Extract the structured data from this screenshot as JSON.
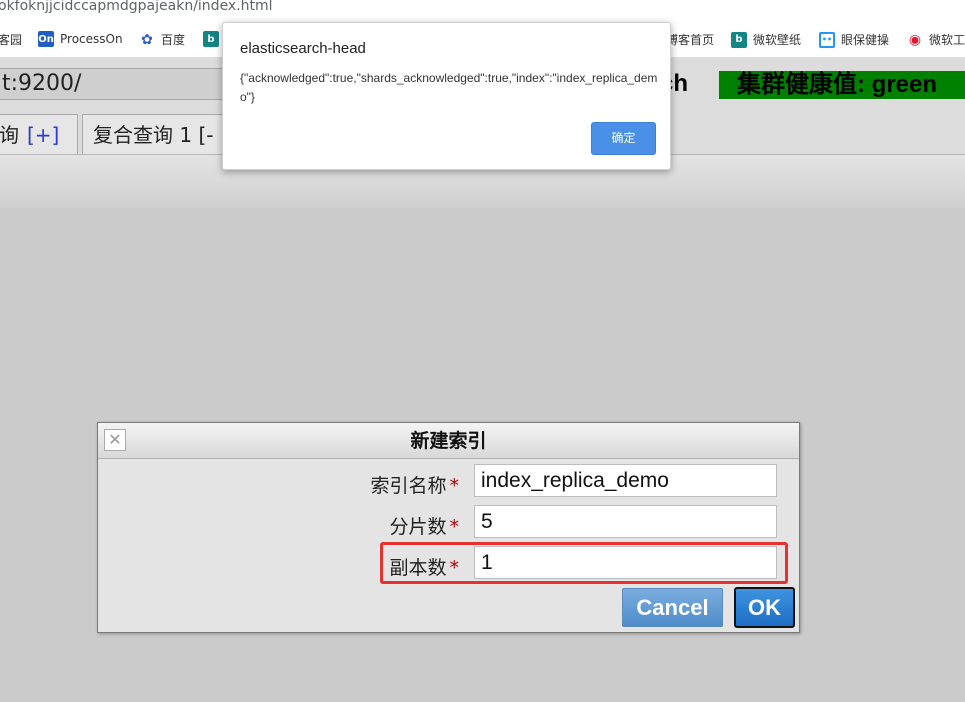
{
  "browser": {
    "url": "okfoknjjcidccapmdgpajeakn/index.html",
    "bookmarks": [
      {
        "label": "客园",
        "icon": "none"
      },
      {
        "label": "ProcessOn",
        "icon": "processon-icon"
      },
      {
        "label": "百度",
        "icon": "baidu-paw-icon"
      },
      {
        "label": "",
        "icon": "bing-icon"
      },
      {
        "label": "博客首页",
        "icon": "none"
      },
      {
        "label": "微软壁纸",
        "icon": "bing-icon"
      },
      {
        "label": "眼保健操",
        "icon": "bilibili-icon"
      },
      {
        "label": "微软工",
        "icon": "weibo-icon"
      }
    ]
  },
  "es_head": {
    "connection_url": "t:9200/",
    "brand_fragment": "ch",
    "cluster_health": "集群健康值: green",
    "tabs": [
      {
        "label": "询",
        "plus": "[+]"
      },
      {
        "label": "复合查询 1",
        "plus": "[-"
      }
    ]
  },
  "alert": {
    "title": "elasticsearch-head",
    "message": "{\"acknowledged\":true,\"shards_acknowledged\":true,\"index\":\"index_replica_demo\"}",
    "ok_label": "确定"
  },
  "dialog": {
    "title": "新建索引",
    "close_glyph": "✕",
    "fields": [
      {
        "label": "索引名称",
        "required": "*",
        "value": "index_replica_demo"
      },
      {
        "label": "分片数",
        "required": "*",
        "value": "5"
      },
      {
        "label": "副本数",
        "required": "*",
        "value": "1"
      }
    ],
    "cancel_label": "Cancel",
    "ok_label": "OK"
  },
  "colors": {
    "health_green": "#008000",
    "highlight_red": "#e8312f",
    "alert_button": "#4a8fe8"
  }
}
